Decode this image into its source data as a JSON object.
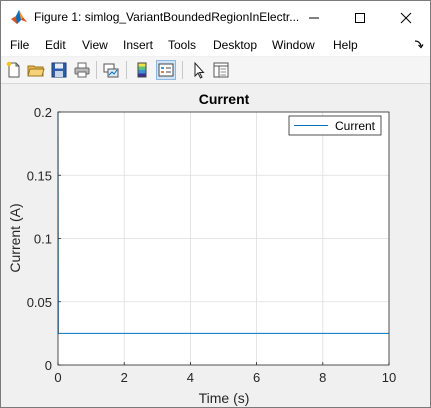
{
  "window": {
    "title": "Figure 1: simlog_VariantBoundedRegionInElectr..."
  },
  "menubar": {
    "items": [
      "File",
      "Edit",
      "View",
      "Insert",
      "Tools",
      "Desktop",
      "Window",
      "Help"
    ]
  },
  "toolbar": {
    "buttons": [
      "new-figure",
      "open-file",
      "save",
      "print",
      "link-plot",
      "insert-colorbar",
      "insert-legend",
      "edit-plot",
      "property-inspector"
    ]
  },
  "chart_data": {
    "type": "line",
    "title": "Current",
    "xlabel": "Time (s)",
    "ylabel": "Current (A)",
    "xlim": [
      0,
      10
    ],
    "ylim": [
      0,
      0.2
    ],
    "xticks": [
      "0",
      "2",
      "4",
      "6",
      "8",
      "10"
    ],
    "yticks": [
      "0",
      "0.05",
      "0.1",
      "0.15",
      "0.2"
    ],
    "grid": true,
    "legend_position": "top-right",
    "series": [
      {
        "name": "Current",
        "color": "#0072bd",
        "x": [
          0,
          0,
          0.01,
          10
        ],
        "y": [
          0.2,
          0.2,
          0.025,
          0.025
        ]
      }
    ]
  }
}
